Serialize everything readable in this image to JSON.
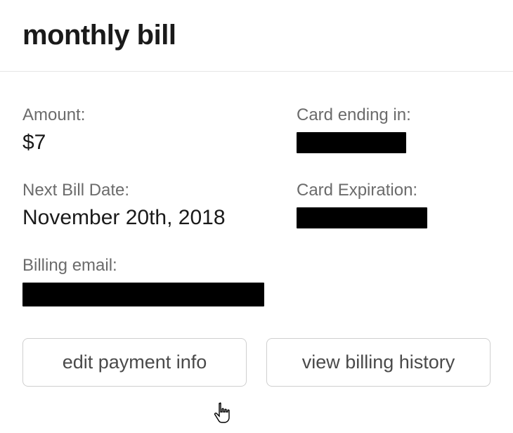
{
  "header": {
    "title": "monthly bill"
  },
  "fields": {
    "amount": {
      "label": "Amount:",
      "value": "$7"
    },
    "card_ending": {
      "label": "Card ending in:",
      "redacted": true
    },
    "next_bill_date": {
      "label": "Next Bill Date:",
      "value": "November 20th, 2018"
    },
    "card_expiration": {
      "label": "Card Expiration:",
      "redacted": true
    },
    "billing_email": {
      "label": "Billing email:",
      "redacted": true
    }
  },
  "buttons": {
    "edit_payment": "edit payment info",
    "view_history": "view billing history"
  }
}
